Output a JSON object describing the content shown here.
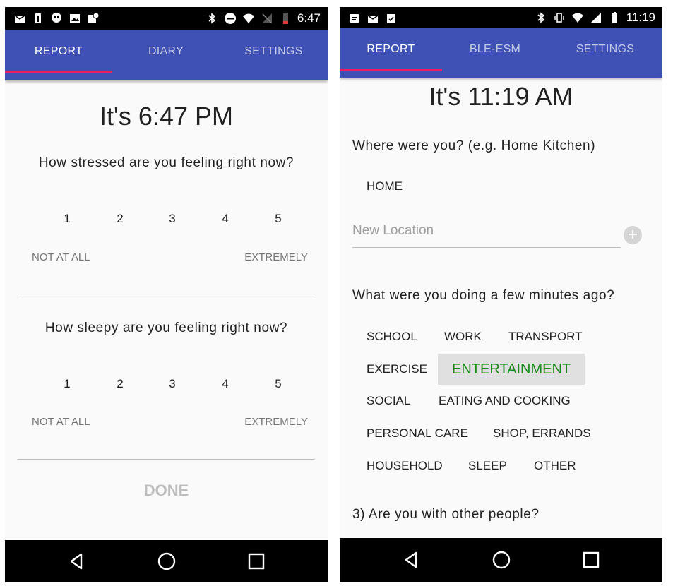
{
  "left": {
    "status": {
      "time": "6:47"
    },
    "tabs": [
      "REPORT",
      "DIARY",
      "SETTINGS"
    ],
    "title": "It's 6:47 PM",
    "questions": [
      {
        "text": "How stressed are you feeling right now?",
        "scale": [
          "1",
          "2",
          "3",
          "4",
          "5"
        ],
        "low": "NOT AT ALL",
        "high": "EXTREMELY"
      },
      {
        "text": "How sleepy are you feeling right now?",
        "scale": [
          "1",
          "2",
          "3",
          "4",
          "5"
        ],
        "low": "NOT AT ALL",
        "high": "EXTREMELY"
      }
    ],
    "done_label": "DONE"
  },
  "right": {
    "status": {
      "time": "11:19"
    },
    "tabs": [
      "REPORT",
      "BLE-ESM",
      "SETTINGS"
    ],
    "title": "It's 11:19 AM",
    "q_where": "Where were you? (e.g. Home Kitchen)",
    "location_option": "HOME",
    "new_location_placeholder": "New Location",
    "q_doing": "What were you doing a few minutes ago?",
    "activities": [
      "SCHOOL",
      "WORK",
      "TRANSPORT",
      "EXERCISE",
      "ENTERTAINMENT",
      "SOCIAL",
      "EATING AND COOKING",
      "PERSONAL CARE",
      "SHOP, ERRANDS",
      "HOUSEHOLD",
      "SLEEP",
      "OTHER"
    ],
    "selected_activity": "ENTERTAINMENT",
    "q_people": "3) Are you with other people?"
  },
  "colors": {
    "appbar": "#3f51b5",
    "indicator": "#e91e63",
    "selected_text": "#1b8a1b"
  }
}
